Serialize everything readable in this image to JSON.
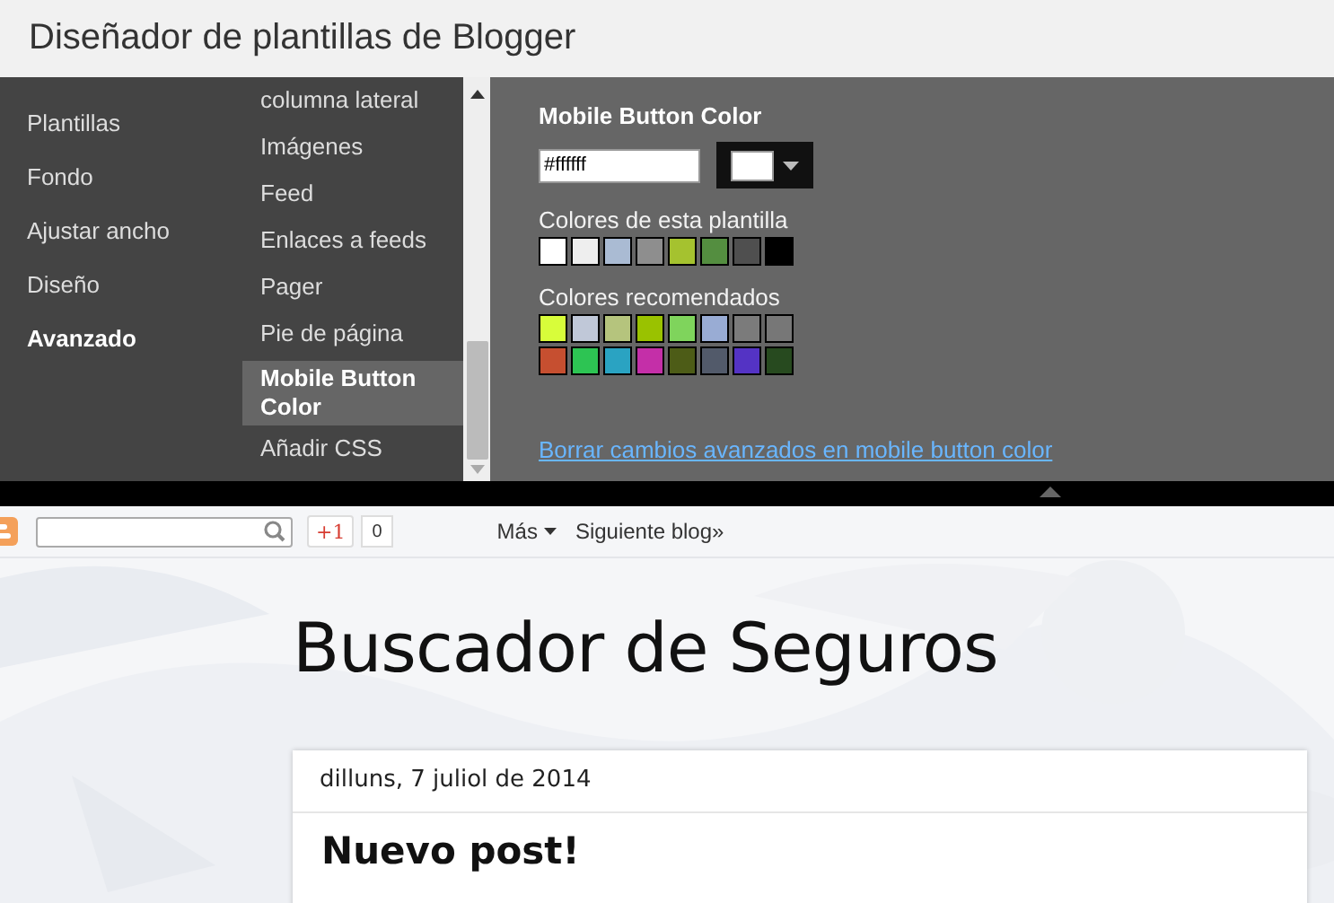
{
  "window": {
    "title": "Diseñador de plantillas de Blogger"
  },
  "sidebar": {
    "items": [
      {
        "label": "Plantillas",
        "selected": false
      },
      {
        "label": "Fondo",
        "selected": false
      },
      {
        "label": "Ajustar ancho",
        "selected": false
      },
      {
        "label": "Diseño",
        "selected": false
      },
      {
        "label": "Avanzado",
        "selected": true
      }
    ]
  },
  "subsections": {
    "items": [
      {
        "label": "columna lateral",
        "selected": false
      },
      {
        "label": "Imágenes",
        "selected": false
      },
      {
        "label": "Feed",
        "selected": false
      },
      {
        "label": "Enlaces a feeds",
        "selected": false
      },
      {
        "label": "Pager",
        "selected": false
      },
      {
        "label": "Pie de página",
        "selected": false
      },
      {
        "label": "Mobile Button Color",
        "selected": true
      },
      {
        "label": "Añadir CSS",
        "selected": false
      }
    ]
  },
  "editor": {
    "heading": "Mobile Button Color",
    "value": "#ffffff",
    "preview": {
      "color": "#ffffff"
    },
    "template_colors_label": "Colores de esta plantilla",
    "template_colors": [
      {
        "color": "#ffffff"
      },
      {
        "color": "#eeeeee"
      },
      {
        "color": "#aabbd3"
      },
      {
        "color": "#8e8e8e"
      },
      {
        "color": "#a5c22f"
      },
      {
        "color": "#548e40"
      },
      {
        "color": "#4f4f4f"
      },
      {
        "color": "#000000"
      }
    ],
    "recommended_label": "Colores recomendados",
    "recommended_colors": [
      {
        "color": "#d8fd3a"
      },
      {
        "color": "#c0c8d8"
      },
      {
        "color": "#b5c47d"
      },
      {
        "color": "#9ac200"
      },
      {
        "color": "#7fd45c"
      },
      {
        "color": "#99acd4"
      },
      {
        "color": "#7b7b7b"
      },
      {
        "color": "#777777"
      },
      {
        "color": "#c64f30"
      },
      {
        "color": "#2dc453"
      },
      {
        "color": "#2aa3c2"
      },
      {
        "color": "#c42fa8"
      },
      {
        "color": "#4d5c17"
      },
      {
        "color": "#525a6a"
      },
      {
        "color": "#5433c4"
      },
      {
        "color": "#274a1f"
      }
    ],
    "reset_link": "Borrar cambios avanzados en mobile button color"
  },
  "navbar": {
    "plus_one": "+1",
    "count": "0",
    "more": "Más",
    "next_blog": "Siguiente blog»"
  },
  "blog": {
    "title": "Buscador de Seguros",
    "post_date": "dilluns, 7 juliol de 2014",
    "post_title": "Nuevo post!"
  }
}
